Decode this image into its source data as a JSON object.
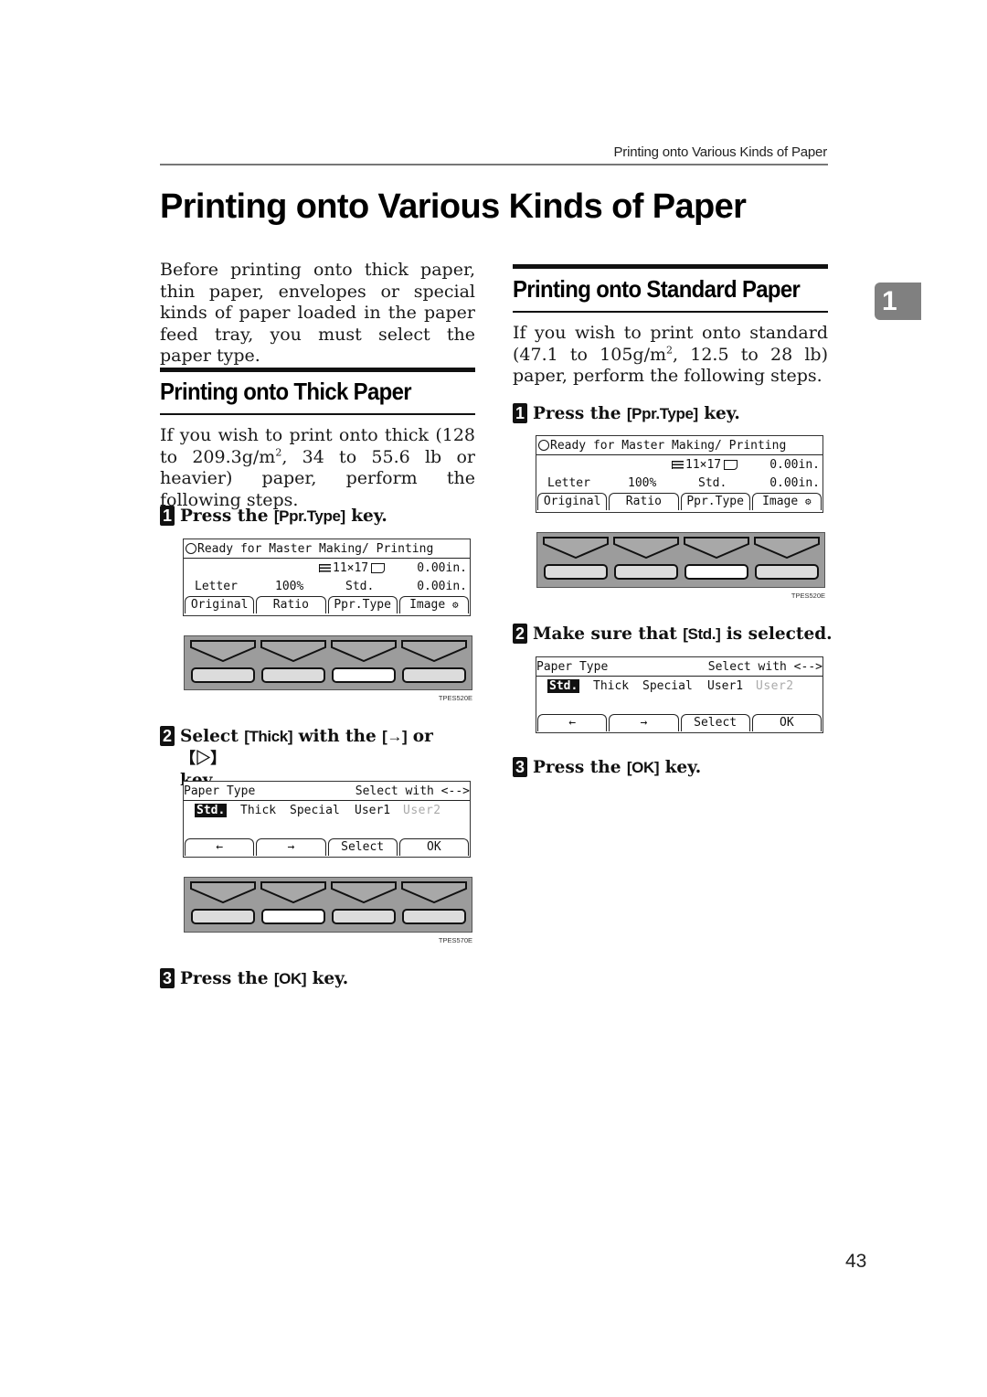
{
  "header": {
    "running_title": "Printing onto Various Kinds of Paper"
  },
  "page": {
    "title": "Printing onto Various Kinds of Paper",
    "intro": "Before printing onto thick paper, thin paper, envelopes or special kinds of paper loaded in the paper feed tray, you must select the paper type.",
    "chapter_tab": "1",
    "page_number": "43"
  },
  "lcd_main": {
    "status": "Ready for Master Making/ Printing",
    "status_icon": "circle-icon",
    "paper_size": "11×17",
    "paper_icons": [
      "tray-icon",
      "paper-orientation-icon"
    ],
    "row1_right": "0.00in.",
    "original": "Letter",
    "ratio": "100%",
    "paper_type": "Std.",
    "row2_right": "0.00in.",
    "buttons": [
      "Original",
      "Ratio",
      "Ppr.Type",
      "Image"
    ],
    "image_button_icon": "image-settings-icon"
  },
  "lcd_paper_type": {
    "title": "Paper Type",
    "hint": "Select with <-->",
    "options": [
      "Std.",
      "Thick",
      "Special",
      "User1",
      "User2"
    ],
    "selected": "Std.",
    "disabled": [
      "User2"
    ],
    "buttons": [
      "←",
      "→",
      "Select",
      "OK"
    ]
  },
  "sections": {
    "thick": {
      "title": "Printing onto Thick Paper",
      "intro_parts": [
        "If you wish to print onto thick (128 to 209.3g/m",
        "2",
        ", 34 to 55.6 lb or heavier) paper, perform the following steps."
      ],
      "steps": [
        {
          "num": "1",
          "pre": "Press the ",
          "key": "[Ppr.Type]",
          "post": " key.",
          "figure": "TPES520E",
          "active_key": 3
        },
        {
          "num": "2",
          "pre": "Select ",
          "key": "[Thick]",
          "mid": " with the ",
          "key2": "[→]",
          "mid2": " or ",
          "key3": "【▷】",
          "post": " key.",
          "figure": "TPES570E",
          "active_key": 2
        },
        {
          "num": "3",
          "pre": "Press the ",
          "key": "[OK]",
          "post": " key."
        }
      ]
    },
    "standard": {
      "title": "Printing onto Standard Paper",
      "intro_parts": [
        "If you wish to print onto standard (47.1 to 105g/m",
        "2",
        ", 12.5 to 28 lb) paper, perform the following steps."
      ],
      "steps": [
        {
          "num": "1",
          "pre": "Press the ",
          "key": "[Ppr.Type]",
          "post": " key.",
          "figure": "TPES520E",
          "active_key": 3
        },
        {
          "num": "2",
          "pre": "Make sure that ",
          "key": "[Std.]",
          "post": " is selected."
        },
        {
          "num": "3",
          "pre": "Press the ",
          "key": "[OK]",
          "post": " key."
        }
      ]
    }
  }
}
